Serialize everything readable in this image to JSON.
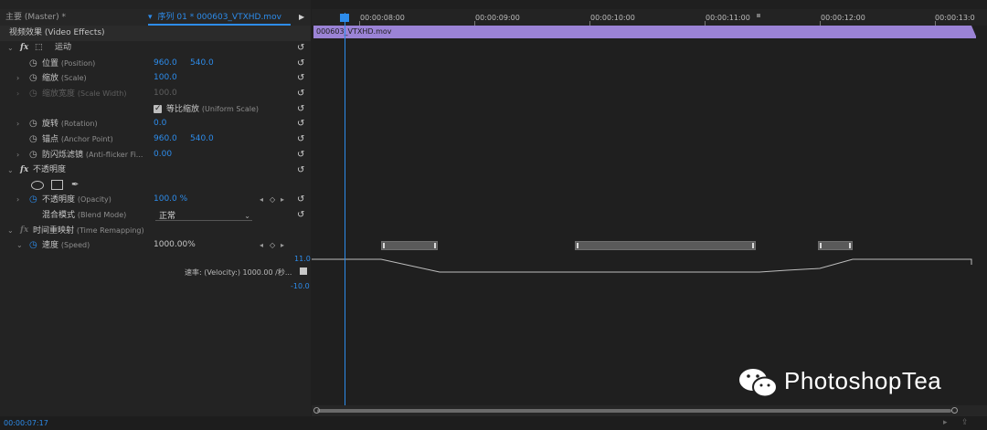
{
  "tabs": {
    "source": "主要 (Master) * 000603_VTXHD.mov",
    "sequence": "序列 01 * 000603_VTXHD.mov"
  },
  "section_header": "视频效果 (Video Effects)",
  "motion": {
    "name": "运动",
    "position": {
      "zh": "位置",
      "en": "(Position)",
      "x": "960.0",
      "y": "540.0"
    },
    "scale": {
      "zh": "缩放",
      "en": "(Scale)",
      "value": "100.0"
    },
    "scale_width": {
      "zh": "缩放宽度",
      "en": "(Scale Width)",
      "value": "100.0"
    },
    "uniform_scale": {
      "zh": "等比缩放",
      "en": "(Uniform Scale)",
      "checked": true
    },
    "rotation": {
      "zh": "旋转",
      "en": "(Rotation)",
      "value": "0.0"
    },
    "anchor": {
      "zh": "锚点",
      "en": "(Anchor Point)",
      "x": "960.0",
      "y": "540.0"
    },
    "anti_flicker": {
      "zh": "防闪烁滤镜",
      "en": "(Anti-flicker Fi...",
      "value": "0.00"
    }
  },
  "opacity": {
    "name": "不透明度",
    "opacity": {
      "zh": "不透明度",
      "en": "(Opacity)",
      "value": "100.0 %"
    },
    "blend": {
      "zh": "混合模式",
      "en": "(Blend Mode)",
      "value": "正常"
    }
  },
  "time_remap": {
    "name": "时间重映射",
    "en": "(Time Remapping)",
    "speed": {
      "zh": "速度",
      "en": "(Speed)",
      "value": "1000.00%"
    },
    "max": "11.0",
    "velocity": "速率: (Velocity:) 1000.00 /秒...",
    "min": "-10.0"
  },
  "ruler": {
    "ticks": [
      "00:00:08:00",
      "00:00:09:00",
      "00:00:10:00",
      "00:00:11:00",
      "00:00:12:00",
      "00:00:13:0"
    ]
  },
  "clip": {
    "name": "000603_VTXHD.mov",
    "color": "#9b83d6"
  },
  "footer": {
    "timecode": "00:00:07:17"
  },
  "watermark": {
    "text": "PhotoshopTea",
    "icon": "wechat-icon"
  },
  "colors": {
    "accent": "#2d8ceb",
    "clip": "#9b83d6"
  }
}
